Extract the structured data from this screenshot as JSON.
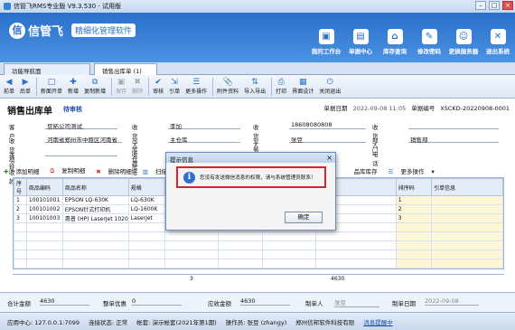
{
  "window": {
    "title": "信管飞RMS专业版 V9.3.530 - 试用版"
  },
  "banner": {
    "brand": "信管飞",
    "slogan": "精细化管理软件",
    "nav": [
      {
        "label": "我的工作台",
        "icon": "monitor-icon",
        "glyph": "▣"
      },
      {
        "label": "单据中心",
        "icon": "documents-icon",
        "glyph": "▤"
      },
      {
        "label": "库存查询",
        "icon": "warehouse-icon",
        "glyph": "⌂"
      },
      {
        "label": "修改密码",
        "icon": "lock-icon",
        "glyph": "✎"
      },
      {
        "label": "更换服务器",
        "icon": "user-server-icon",
        "glyph": "☺"
      },
      {
        "label": "退出系统",
        "icon": "exit-icon",
        "glyph": "✕"
      }
    ]
  },
  "tabs": [
    {
      "label": "功能导航面"
    },
    {
      "label": "销售出库单 (1)"
    }
  ],
  "toolbar": [
    {
      "label": "前单",
      "glyph": "◀",
      "enabled": true
    },
    {
      "label": "后单",
      "glyph": "▶",
      "enabled": true
    },
    {
      "label": "新面开单",
      "glyph": "□",
      "enabled": true
    },
    {
      "label": "新增",
      "glyph": "✚",
      "enabled": true
    },
    {
      "label": "复制新增",
      "glyph": "⧉",
      "enabled": true
    },
    {
      "label": "保存",
      "glyph": "▣",
      "enabled": false
    },
    {
      "label": "删除",
      "glyph": "✖",
      "enabled": false
    },
    {
      "label": "审核",
      "glyph": "✔",
      "enabled": true
    },
    {
      "label": "引单",
      "glyph": "⇲",
      "enabled": true
    },
    {
      "label": "更多操作",
      "glyph": "☰",
      "enabled": true
    },
    {
      "label": "附件资料",
      "glyph": "📎",
      "enabled": true
    },
    {
      "label": "导入导出",
      "glyph": "⇅",
      "enabled": true
    },
    {
      "label": "打印",
      "glyph": "⎙",
      "enabled": true
    },
    {
      "label": "界面设计",
      "glyph": "▦",
      "enabled": true
    },
    {
      "label": "关闭退出",
      "glyph": "⏻",
      "enabled": true
    }
  ],
  "doc": {
    "title": "销售出库单",
    "status": "待审核",
    "date_label": "单据日期",
    "date": "2022-09-08 11:05",
    "no_label": "单据编号",
    "no": "XSCKD-20220908-0001"
  },
  "fields": {
    "customer": {
      "label": "客户",
      "value": "豆拓公司测试"
    },
    "receiver": {
      "label": "收货人",
      "value": "李加"
    },
    "receiver_phone": {
      "label": "收货人手机",
      "value": "18608080808"
    },
    "receiver_tel": {
      "label": "收货人电话",
      "value": ""
    },
    "address": {
      "label": "收货地址",
      "value": "河南省郑州市中原区河南省"
    },
    "warehouse": {
      "label": "出库仓库",
      "value": "主仓库"
    },
    "salesman": {
      "label": "业务员",
      "value": "张豆"
    },
    "dept": {
      "label": "部门",
      "value": "销售部"
    },
    "receipt": {
      "label": "本次收款",
      "value": ""
    },
    "account": {
      "label": "收款账户",
      "value": ""
    }
  },
  "grid": {
    "toolbar": [
      "添加明细",
      "复制明细",
      "删除明细",
      "扫描条形码 (F5)"
    ],
    "right_tools": [
      "品库库存",
      "更多操作"
    ],
    "headers": [
      "序号",
      "商品编码",
      "商品名称",
      "规格",
      "数量",
      "单价",
      "金额",
      "备注",
      "排序码",
      "引单信息"
    ],
    "rows": [
      [
        "1",
        "100101001",
        "EPSON LQ-630K",
        "LQ-630K",
        "1",
        "",
        "",
        "",
        "1",
        ""
      ],
      [
        "2",
        "100101002",
        "EPSON针式打印机",
        "LQ-1600K",
        "",
        "",
        "",
        "",
        "2",
        ""
      ],
      [
        "3",
        "100101003",
        "惠普 (HP) LaserJet 1020",
        "LaserJet",
        "",
        "",
        "",
        "",
        "3",
        ""
      ]
    ],
    "footer_qty": "3",
    "footer_amount": "4630"
  },
  "summary": {
    "total_label": "合计金额",
    "total": "4630",
    "discount_label": "整单优惠",
    "discount": "0",
    "receivable_label": "应收金额",
    "receivable": "4630",
    "maker_label": "制单人",
    "maker": "张豆",
    "make_date_label": "制单日期",
    "make_date": "2022-09-08"
  },
  "statusbar": {
    "app_center": "应用中心: 127.0.0.1:7099",
    "connection": "连接状态: 正常",
    "account_set": "帐套: 演示帐套(2021年第1期)",
    "operator": "操作员: 张豆 (zhangy)",
    "company": "郑州信邦软件科技有限",
    "message": "消息提醒中"
  },
  "dialog": {
    "title": "提示信息",
    "message": "您没有发送微信消息的权限，请与系统管理员联系！",
    "ok": "确定"
  }
}
